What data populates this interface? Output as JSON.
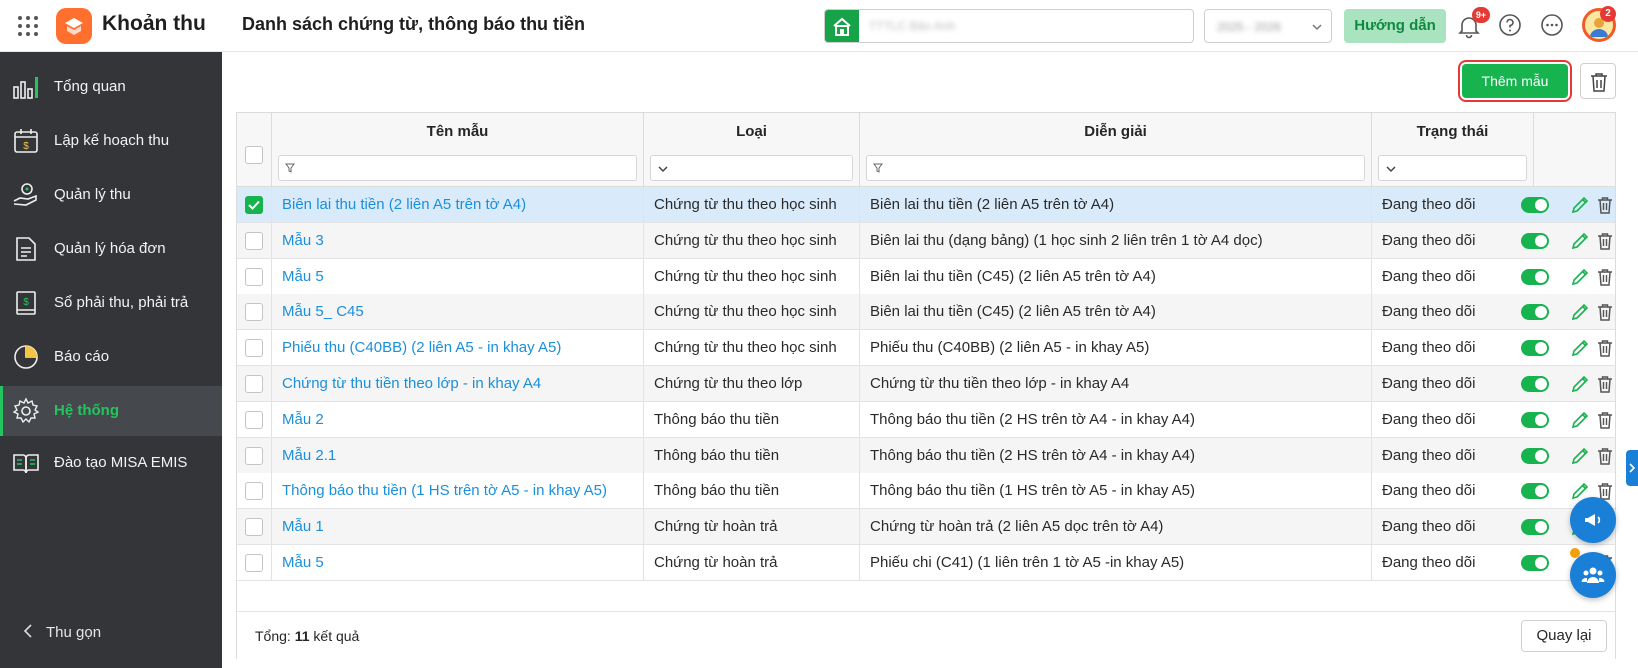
{
  "header": {
    "app_name": "Khoản thu",
    "page_title": "Danh sách chứng từ, thông báo thu tiền",
    "school_name": "TTTLC Bảo Anh",
    "year": "2025 - 2026",
    "guide_label": "Hướng dẫn",
    "notification_count": "9+",
    "avatar_badge": "2"
  },
  "sidebar": {
    "items": [
      {
        "label": "Tổng quan",
        "icon": "bar-chart-icon"
      },
      {
        "label": "Lập kế hoạch thu",
        "icon": "calendar-money-icon"
      },
      {
        "label": "Quản lý thu",
        "icon": "hand-coin-icon"
      },
      {
        "label": "Quản lý hóa đơn",
        "icon": "invoice-icon"
      },
      {
        "label": "Sổ phải thu, phải trả",
        "icon": "ledger-icon"
      },
      {
        "label": "Báo cáo",
        "icon": "pie-chart-icon"
      },
      {
        "label": "Hệ thống",
        "icon": "gear-icon"
      },
      {
        "label": "Đào tạo MISA EMIS",
        "icon": "book-icon"
      }
    ],
    "active_index": 6,
    "collapse_label": "Thu gọn"
  },
  "toolbar": {
    "add_label": "Thêm mẫu"
  },
  "table": {
    "columns": [
      "Tên mẫu",
      "Loại",
      "Diễn giải",
      "Trạng thái"
    ],
    "rows": [
      {
        "name": "Biên lai thu tiền (2 liên A5 trên tờ A4)",
        "type": "Chứng từ thu theo học sinh",
        "desc": "Biên lai thu tiền (2 liên A5 trên tờ A4)",
        "status": "Đang theo dõi",
        "checked": true
      },
      {
        "name": "Mẫu 3",
        "type": "Chứng từ thu theo học sinh",
        "desc": "Biên lai thu (dạng bảng) (1 học sinh 2 liên trên 1 tờ A4 dọc)",
        "status": "Đang theo dõi",
        "checked": false
      },
      {
        "name": "Mẫu 5",
        "type": "Chứng từ thu theo học sinh",
        "desc": "Biên lai thu tiền (C45) (2 liên A5 trên tờ A4)",
        "status": "Đang theo dõi",
        "checked": false
      },
      {
        "name": "Mẫu 5_ C45",
        "type": "Chứng từ thu theo học sinh",
        "desc": "Biên lai thu tiền (C45) (2 liên A5 trên tờ A4)",
        "status": "Đang theo dõi",
        "checked": false
      },
      {
        "name": "Phiếu thu (C40BB) (2 liên A5 - in khay A5)",
        "type": "Chứng từ thu theo học sinh",
        "desc": "Phiếu thu (C40BB) (2 liên A5 - in khay A5)",
        "status": "Đang theo dõi",
        "checked": false
      },
      {
        "name": "Chứng từ thu tiền theo lớp - in khay A4",
        "type": "Chứng từ thu theo lớp",
        "desc": "Chứng từ thu tiền theo lớp - in khay A4",
        "status": "Đang theo dõi",
        "checked": false
      },
      {
        "name": "Mẫu 2",
        "type": "Thông báo thu tiền",
        "desc": "Thông báo thu tiền (2 HS trên tờ A4 - in khay A4)",
        "status": "Đang theo dõi",
        "checked": false
      },
      {
        "name": "Mẫu 2.1",
        "type": "Thông báo thu tiền",
        "desc": "Thông báo thu tiền (2 HS trên tờ A4 - in khay A4)",
        "status": "Đang theo dõi",
        "checked": false
      },
      {
        "name": "Thông báo thu tiền (1 HS trên tờ A5 - in khay A5)",
        "type": "Thông báo thu tiền",
        "desc": "Thông báo thu tiền (1 HS trên tờ A5 - in khay A5)",
        "status": "Đang theo dõi",
        "checked": false
      },
      {
        "name": "Mẫu 1",
        "type": "Chứng từ hoàn trả",
        "desc": "Chứng từ hoàn trả (2 liên A5 dọc trên tờ A4)",
        "status": "Đang theo dõi",
        "checked": false
      },
      {
        "name": "Mẫu 5",
        "type": "Chứng từ hoàn trả",
        "desc": "Phiếu chi (C41) (1 liên trên 1 tờ A5 -in khay A5)",
        "status": "Đang theo dõi",
        "checked": false
      }
    ]
  },
  "footer": {
    "total_label": "Tổng:",
    "total_count": "11",
    "total_suffix": "kết quả",
    "back_label": "Quay lại"
  },
  "colors": {
    "accent": "#16b34f",
    "link": "#1a8fdc",
    "sidebar_bg": "#333538",
    "selected_row": "#d9ebfb",
    "highlight_outline": "#e53935"
  }
}
